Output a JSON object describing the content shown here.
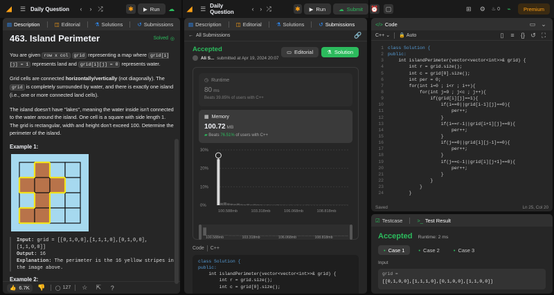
{
  "left": {
    "topbar_title": "Daily Question",
    "run_label": "Run",
    "tabs": [
      "Description",
      "Editorial",
      "Solutions",
      "Submissions"
    ],
    "problem_title": "463. Island Perimeter",
    "solved_label": "Solved",
    "desc": {
      "p1a": "You are given ",
      "p1code1": "row x col",
      "p1b": " ",
      "p1code2": "grid",
      "p1c": " representing a map where ",
      "p1code3": "grid[i][j] = 1",
      "p1d": " represents land and ",
      "p1code4": "grid[i][j] = 0",
      "p1e": " represents water.",
      "p2a": "Grid cells are connected ",
      "p2bold": "horizontally/vertically",
      "p2b": " (not diagonally). The ",
      "p2code": "grid",
      "p2c": " is completely surrounded by water, and there is exactly one island (i.e., one or more connected land cells).",
      "p3": "The island doesn't have \"lakes\", meaning the water inside isn't connected to the water around the island. One cell is a square with side length 1. The grid is rectangular, width and height don't exceed 100. Determine the perimeter of the island.",
      "example_label": "Example 1:",
      "input_label": "Input:",
      "input_value": " grid = [[0,1,0,0],[1,1,1,0],[0,1,0,0],[1,1,0,0]]",
      "output_label": "Output:",
      "output_value": " 16",
      "explanation_label": "Explanation:",
      "explanation_value": " The perimeter is the 16 yellow stripes in the image above.",
      "example2_label": "Example 2:",
      "grid": [
        [
          0,
          1,
          0,
          0
        ],
        [
          1,
          1,
          1,
          0
        ],
        [
          0,
          1,
          0,
          0
        ],
        [
          1,
          1,
          0,
          0
        ]
      ]
    },
    "likes": "6.7K",
    "comments": "127"
  },
  "middle": {
    "topbar_title": "Daily Question",
    "run_label": "Run",
    "submit_label": "Submit",
    "tabs": [
      "Description",
      "Editorial",
      "Solutions",
      "Submissions"
    ],
    "all_submissions": "All Submissions",
    "status": "Accepted",
    "user": "Ali S...",
    "submitted_at": "submitted at Apr 19, 2024 20:07",
    "editorial_btn": "Editorial",
    "solution_btn": "Solution",
    "runtime_label": "Runtime",
    "runtime_value": "80",
    "runtime_unit": "ms",
    "runtime_beats": "Beats 39.85% of users with C++",
    "memory_label": "Memory",
    "memory_value": "100.72",
    "memory_unit": "MB",
    "memory_beats_pre": "Beats ",
    "memory_beats_pct": "76.51%",
    "memory_beats_post": " of users with C++",
    "code_label": "Code",
    "code_lang": "C++",
    "code_lines": [
      "class Solution {",
      "public:",
      "    int islandPerimeter(vector<vector<int>>& grid) {",
      "        int r = grid.size();",
      "        int c = grid[0].size();"
    ]
  },
  "chart_data": {
    "type": "bar",
    "y_ticks": [
      "30%",
      "20%",
      "10%",
      "0%"
    ],
    "ylim": [
      0,
      30
    ],
    "x_ticks": [
      "100.588mb",
      "103.318mb",
      "106.068mb",
      "108.818mb"
    ],
    "mini_x_ticks": [
      "100.588mb",
      "103.318mb",
      "106.068mb",
      "108.818mb"
    ],
    "values": [
      25,
      1.2,
      1.5,
      1.0,
      0.8,
      0.6,
      0.9,
      0.5,
      0.4,
      0.6,
      0.3,
      0.5,
      0.4,
      0.3,
      0.2,
      0.3,
      0.2,
      0.2,
      0.3,
      0.2,
      0.2,
      0.1,
      0.2,
      0.1,
      0.2,
      0.1,
      0.1,
      0.2,
      0.1,
      0.1,
      0.1,
      0.1,
      0.1,
      0.1,
      0.1,
      0.1,
      0.1,
      0.1,
      0.1,
      0.1
    ],
    "marker_index": 0
  },
  "right": {
    "premium": "Premium",
    "streak": "0",
    "code_tab": "Code",
    "lang": "C++",
    "auto": "Auto",
    "code_lines": [
      "class Solution {",
      "public:",
      "    int islandPerimeter(vector<vector<int>>& grid) {",
      "        int r = grid.size();",
      "        int c = grid[0].size();",
      "        int per = 0;",
      "        for(int i=0 ; i<r ; i++){",
      "            for(int j=0 ; j<c ; j++){",
      "                if(grid[i][j]==1){",
      "                    if(i==0||grid[i-1][j]==0){",
      "                        per++;",
      "                    }",
      "                    if(i==r-1||grid[i+1][j]==0){",
      "                        per++;",
      "                    }",
      "                    if(j==0||grid[i][j-1]==0){",
      "                        per++;",
      "                    }",
      "                    if(j==c-1||grid[i][j+1]==0){",
      "                        per++;",
      "                    }",
      "                }",
      "            }",
      "        }"
    ],
    "saved": "Saved",
    "cursor": "Ln 25, Col 20",
    "testcase_tab": "Testcase",
    "test_result_tab": "Test Result",
    "result_status": "Accepted",
    "result_runtime": "Runtime: 2 ms",
    "cases": [
      "Case 1",
      "Case 2",
      "Case 3"
    ],
    "input_label": "Input",
    "input_var": "grid =",
    "input_value": "[[0,1,0,0],[1,1,1,0],[0,1,0,0],[1,1,0,0]]"
  }
}
